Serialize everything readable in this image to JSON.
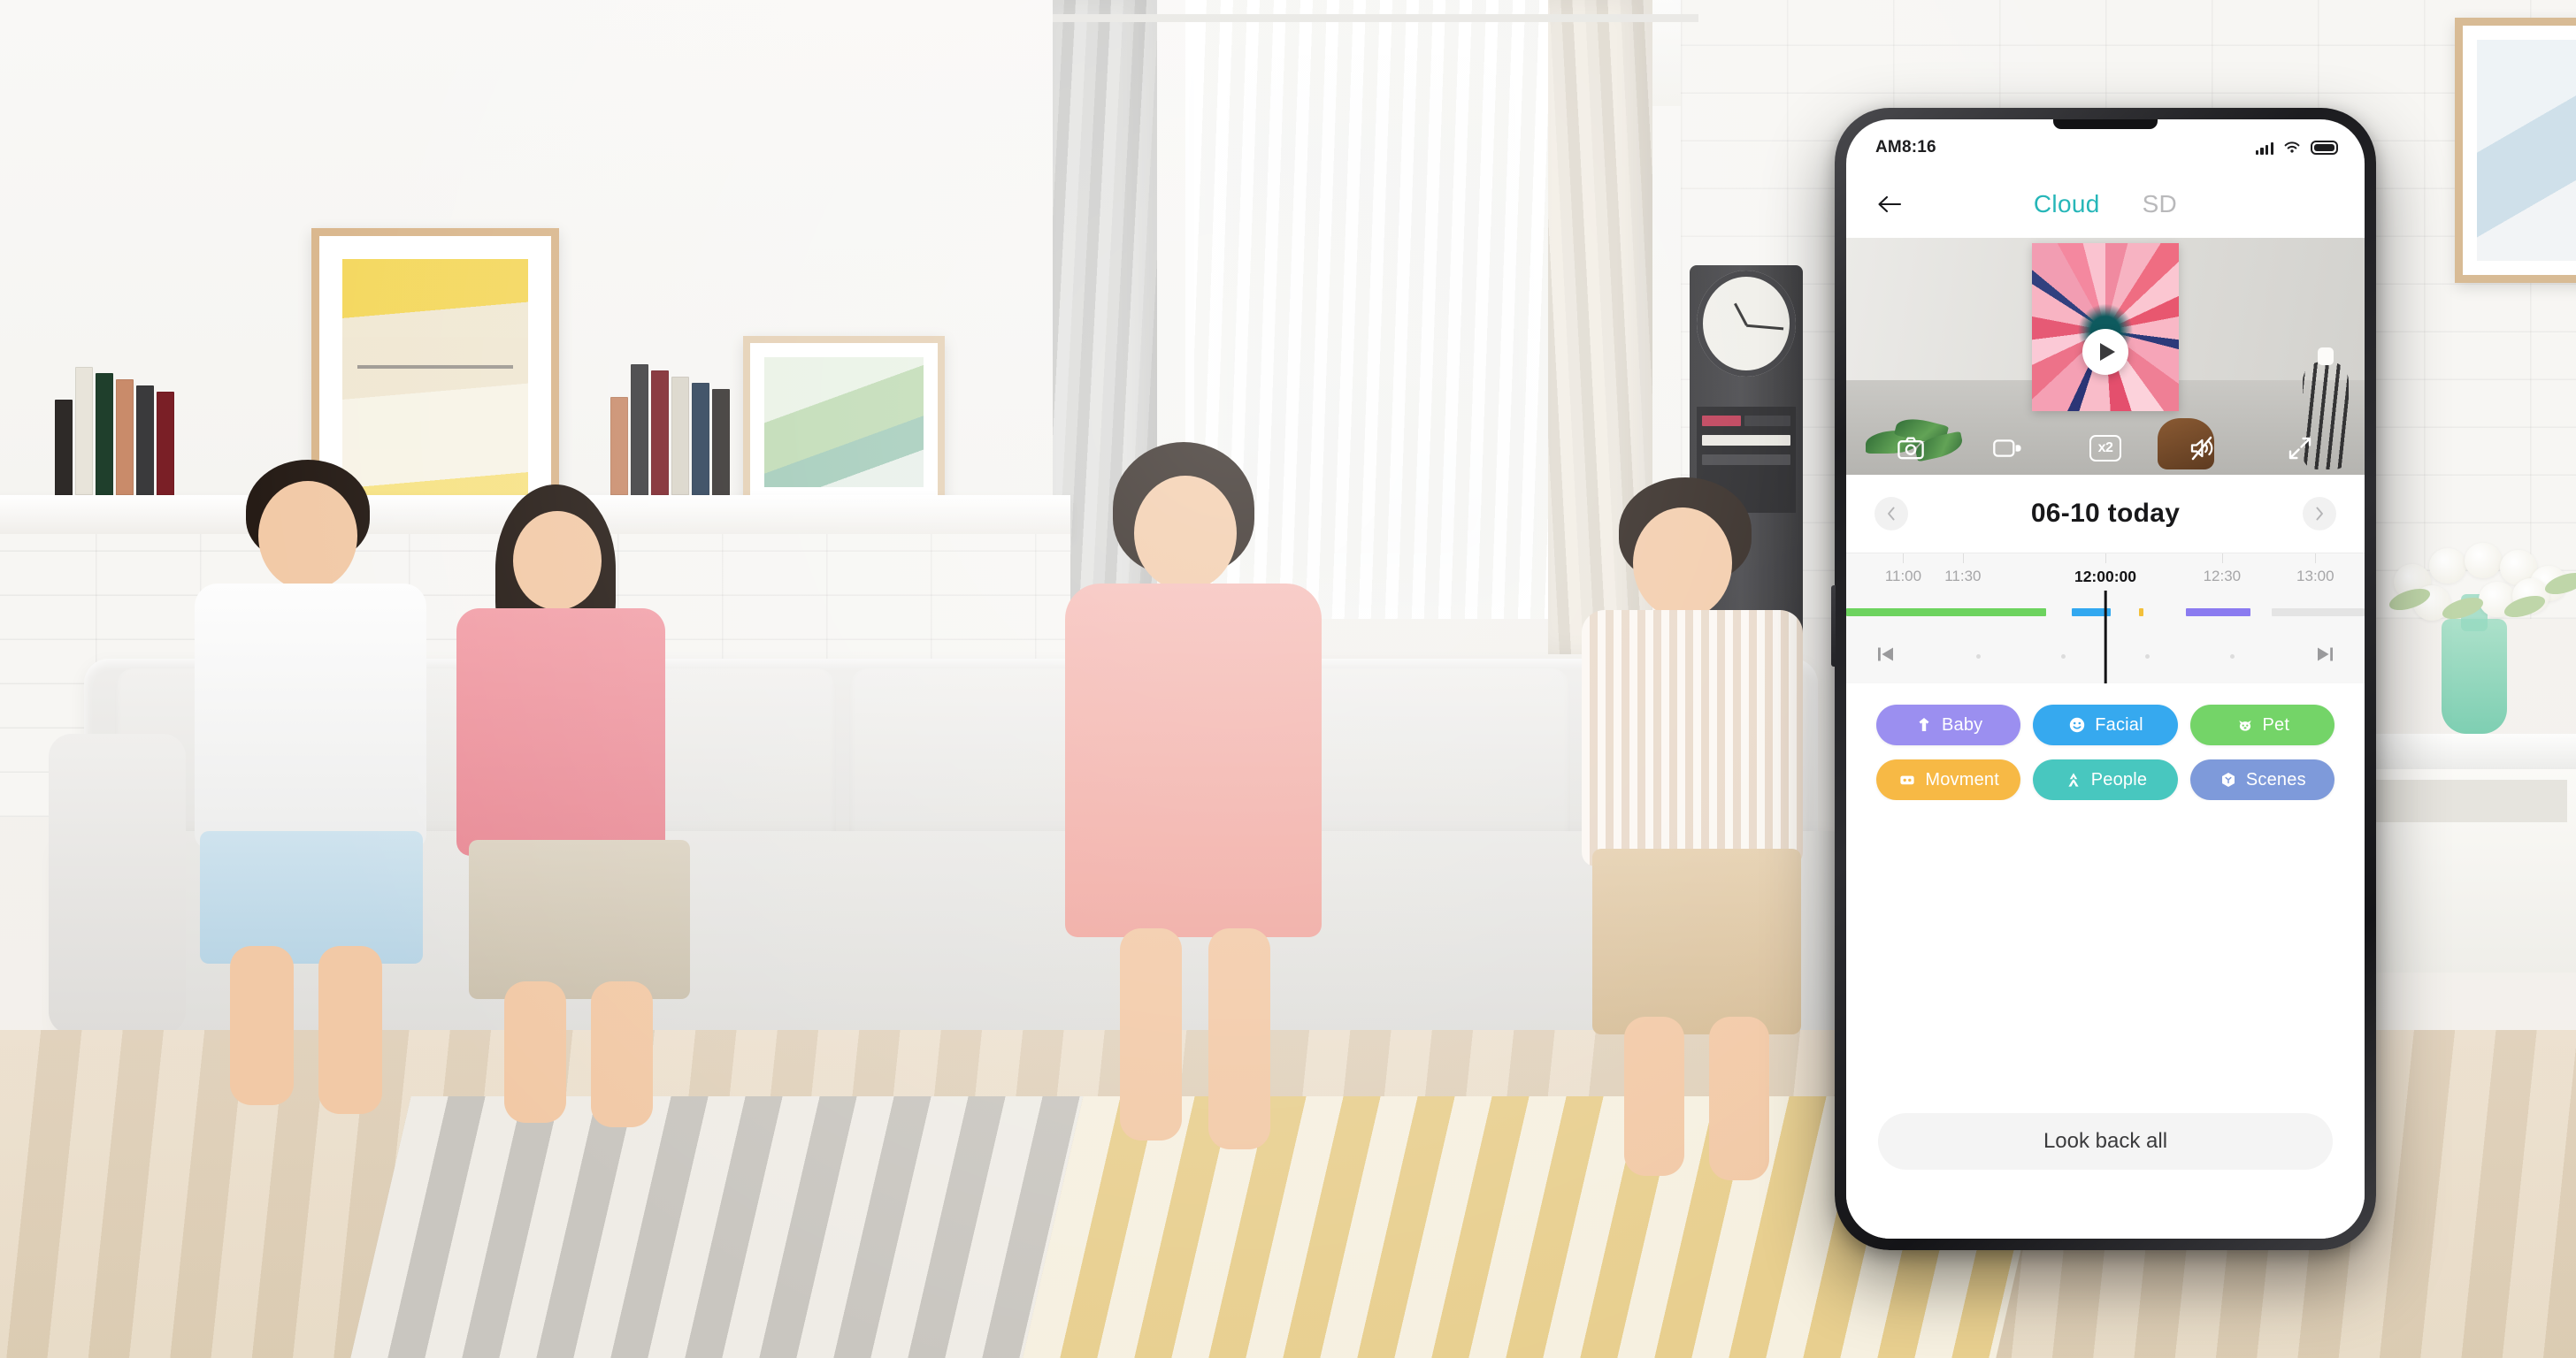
{
  "phone": {
    "statusbar": {
      "time": "AM8:16",
      "icons": [
        "signal-bars-icon",
        "wifi-icon",
        "battery-icon"
      ]
    },
    "navbar": {
      "back_icon": "back-arrow-icon",
      "tabs": [
        {
          "label": "Cloud",
          "active": true
        },
        {
          "label": "SD",
          "active": false
        }
      ]
    },
    "video": {
      "play_icon": "play-icon",
      "controls": [
        {
          "name": "snapshot",
          "icon": "camera-icon",
          "label": ""
        },
        {
          "name": "record",
          "icon": "video-camera-icon",
          "label": ""
        },
        {
          "name": "speed",
          "icon": "speed-box-icon",
          "label": "x2"
        },
        {
          "name": "mute",
          "icon": "speaker-muted-icon",
          "label": ""
        },
        {
          "name": "fullscreen",
          "icon": "expand-arrows-icon",
          "label": ""
        }
      ]
    },
    "date_nav": {
      "prev_icon": "chevron-left-icon",
      "next_icon": "chevron-right-icon",
      "date_label": "06-10 today"
    },
    "timeline": {
      "labels": [
        {
          "text": "11:00",
          "pos": 11.0,
          "current": false
        },
        {
          "text": "11:30",
          "pos": 22.5,
          "current": false
        },
        {
          "text": "12:00:00",
          "pos": 50.0,
          "current": true
        },
        {
          "text": "12:30",
          "pos": 72.5,
          "current": false
        },
        {
          "text": "13:00",
          "pos": 90.5,
          "current": false
        }
      ],
      "playhead_pos": 50.0,
      "playhead_time": "12:00:00",
      "segments": [
        {
          "name": "green-event",
          "start": 0.0,
          "width": 38.5,
          "color": "#6dd35f"
        },
        {
          "name": "blue-event",
          "start": 43.5,
          "width": 7.5,
          "color": "#32a8f0"
        },
        {
          "name": "yellow-event",
          "start": 56.5,
          "width": 0.8,
          "color": "#f3c03a"
        },
        {
          "name": "purple-event",
          "start": 65.5,
          "width": 12.5,
          "color": "#8b7bf0"
        },
        {
          "name": "empty-track",
          "start": 82.0,
          "width": 18.0,
          "color": "#e4e4e4"
        }
      ],
      "skip_prev_icon": "skip-previous-icon",
      "skip_next_icon": "skip-next-icon",
      "dots": 4
    },
    "filters": [
      {
        "label": "Baby",
        "color": "#9b8ff0",
        "icon": "baby-onesie-icon"
      },
      {
        "label": "Facial",
        "color": "#36a9ef",
        "icon": "smiley-face-icon"
      },
      {
        "label": "Pet",
        "color": "#74d468",
        "icon": "pet-head-icon"
      },
      {
        "label": "Movment",
        "color": "#f7b945",
        "icon": "motion-box-icon"
      },
      {
        "label": "People",
        "color": "#48c7bf",
        "icon": "person-walking-icon"
      },
      {
        "label": "Scenes",
        "color": "#7e9ada",
        "icon": "cube-scene-icon"
      }
    ],
    "footer": {
      "lookback_label": "Look back all"
    }
  },
  "theme": {
    "accent_teal": "#26b6b8",
    "inactive_gray": "#b9b9bb",
    "text_dark": "#18181a",
    "timeline_bg": "#f7f7f7",
    "button_bg": "#f4f4f4"
  }
}
